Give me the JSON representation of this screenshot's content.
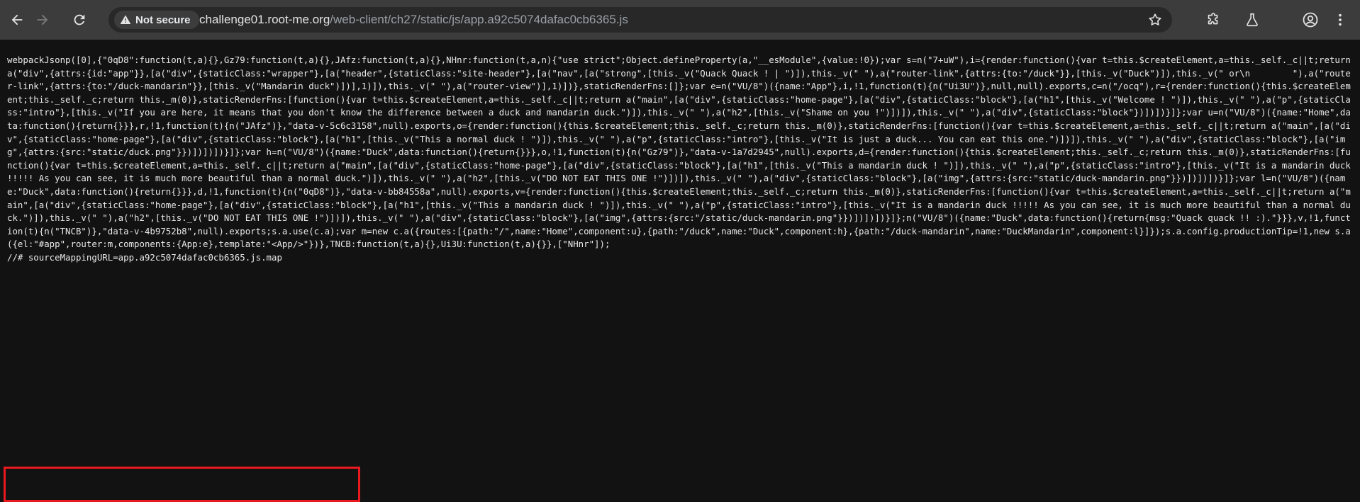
{
  "browser": {
    "security_label": "Not secure",
    "url_host": "challenge01.root-me.org",
    "url_path": "/web-client/ch27/static/js/app.a92c5074dafac0cb6365.js",
    "icons": [
      "back-icon",
      "forward-icon",
      "reload-icon",
      "warning-icon",
      "star-icon",
      "extension-icon",
      "labs-icon",
      "profile-icon",
      "menu-icon"
    ]
  },
  "content": {
    "code": "webpackJsonp([0],{\"0qD8\":function(t,a){},Gz79:function(t,a){},JAfz:function(t,a){},NHnr:function(t,a,n){\"use strict\";Object.defineProperty(a,\"__esModule\",{value:!0});var s=n(\"7+uW\"),i={render:function(){var t=this.$createElement,a=this._self._c||t;return a(\"div\",{attrs:{id:\"app\"}},[a(\"div\",{staticClass:\"wrapper\"},[a(\"header\",{staticClass:\"site-header\"},[a(\"nav\",[a(\"strong\",[this._v(\"Quack Quack ! | \")]),this._v(\" \"),a(\"router-link\",{attrs:{to:\"/duck\"}},[this._v(\"Duck\")]),this._v(\" or\\n        \"),a(\"router-link\",{attrs:{to:\"/duck-mandarin\"}},[this._v(\"Mandarin duck\")])],1)]),this._v(\" \"),a(\"router-view\")],1)])},staticRenderFns:[]};var e=n(\"VU/8\")({name:\"App\"},i,!1,function(t){n(\"Ui3U\")},null,null).exports,c=n(\"/ocq\"),r={render:function(){this.$createElement;this._self._c;return this._m(0)},staticRenderFns:[function(){var t=this.$createElement,a=this._self._c||t;return a(\"main\",[a(\"div\",{staticClass:\"home-page\"},[a(\"div\",{staticClass:\"block\"},[a(\"h1\",[this._v(\"Welcome ! \")]),this._v(\" \"),a(\"p\",{staticClass:\"intro\"},[this._v(\"If you are here, it means that you don't know the difference between a duck and mandarin duck.\")]),this._v(\" \"),a(\"h2\",[this._v(\"Shame on you !\")])]),this._v(\" \"),a(\"div\",{staticClass:\"block\"})])])}]};var u=n(\"VU/8\")({name:\"Home\",data:function(){return{}}},r,!1,function(t){n(\"JAfz\")},\"data-v-5c6c3158\",null).exports,o={render:function(){this.$createElement;this._self._c;return this._m(0)},staticRenderFns:[function(){var t=this.$createElement,a=this._self._c||t;return a(\"main\",[a(\"div\",{staticClass:\"home-page\"},[a(\"div\",{staticClass:\"block\"},[a(\"h1\",[this._v(\"This a normal duck ! \")]),this._v(\" \"),a(\"p\",{staticClass:\"intro\"},[this._v(\"It is just a duck... You can eat this one.\")])]),this._v(\" \"),a(\"div\",{staticClass:\"block\"},[a(\"img\",{attrs:{src:\"static/duck.png\"}})])])])}]};var h=n(\"VU/8\")({name:\"Duck\",data:function(){return{}}},o,!1,function(t){n(\"Gz79\")},\"data-v-1a7d2945\",null).exports,d={render:function(){this.$createElement;this._self._c;return this._m(0)},staticRenderFns:[function(){var t=this.$createElement,a=this._self._c||t;return a(\"main\",[a(\"div\",{staticClass:\"home-page\"},[a(\"div\",{staticClass:\"block\"},[a(\"h1\",[this._v(\"This a mandarin duck ! \")]),this._v(\" \"),a(\"p\",{staticClass:\"intro\"},[this._v(\"It is a mandarin duck !!!!! As you can see, it is much more beautiful than a normal duck.\")]),this._v(\" \"),a(\"h2\",[this._v(\"DO NOT EAT THIS ONE !\")])]),this._v(\" \"),a(\"div\",{staticClass:\"block\"},[a(\"img\",{attrs:{src:\"static/duck-mandarin.png\"}})])])])}]};var l=n(\"VU/8\")({name:\"Duck\",data:function(){return{}}},d,!1,function(t){n(\"0qD8\")},\"data-v-bb84558a\",null).exports,v={render:function(){this.$createElement;this._self._c;return this._m(0)},staticRenderFns:[function(){var t=this.$createElement,a=this._self._c||t;return a(\"main\",[a(\"div\",{staticClass:\"home-page\"},[a(\"div\",{staticClass:\"block\"},[a(\"h1\",[this._v(\"This a mandarin duck ! \")]),this._v(\" \"),a(\"p\",{staticClass:\"intro\"},[this._v(\"It is a mandarin duck !!!!! As you can see, it is much more beautiful than a normal duck.\")]),this._v(\" \"),a(\"h2\",[this._v(\"DO NOT EAT THIS ONE !\")])]),this._v(\" \"),a(\"div\",{staticClass:\"block\"},[a(\"img\",{attrs:{src:\"/static/duck-mandarin.png\"}})])])])}]};n(\"VU/8\")({name:\"Duck\",data:function(){return{msg:\"Quack quack !! :).\"}}},v,!1,function(t){n(\"TNCB\")},\"data-v-4b9752b8\",null).exports;s.a.use(c.a);var m=new c.a({routes:[{path:\"/\",name:\"Home\",component:u},{path:\"/duck\",name:\"Duck\",component:h},{path:\"/duck-mandarin\",name:\"DuckMandarin\",component:l}]});s.a.config.productionTip=!1,new s.a({el:\"#app\",router:m,components:{App:e},template:\"<App/>\"})},TNCB:function(t,a){},Ui3U:function(t,a){}},[\"NHnr\"]);\n//# sourceMappingURL=app.a92c5074dafac0cb6365.js.map",
    "highlight_color": "#e8191f"
  }
}
